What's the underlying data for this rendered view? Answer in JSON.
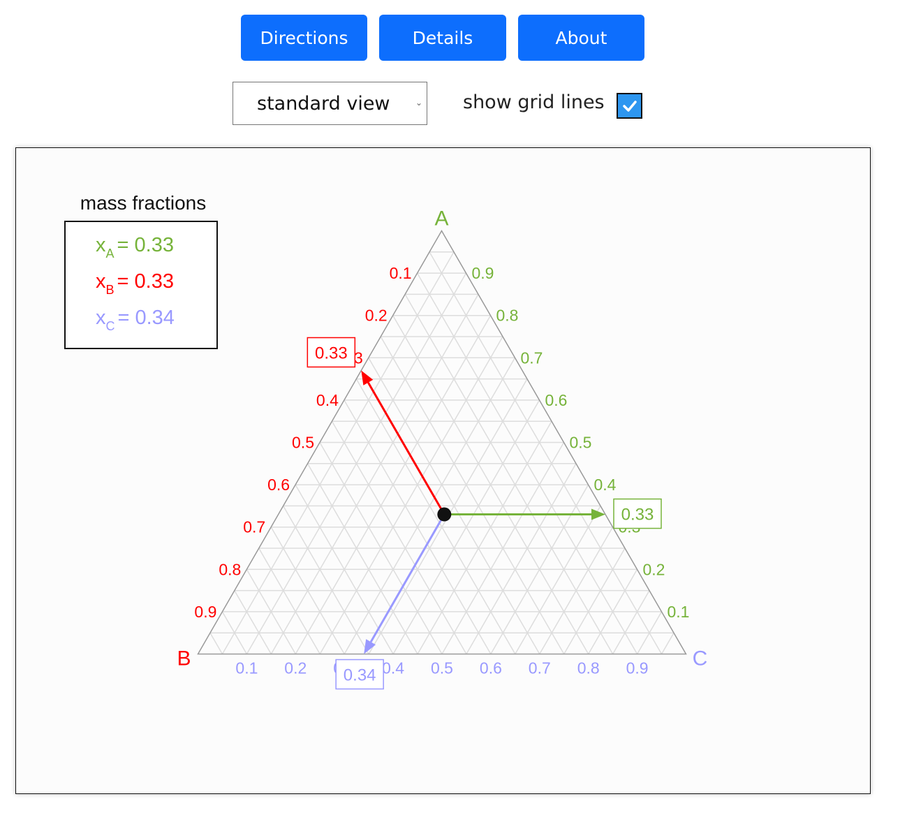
{
  "toolbar": {
    "buttons": [
      {
        "label": "Directions"
      },
      {
        "label": "Details"
      },
      {
        "label": "About"
      }
    ],
    "view_select": {
      "value": "standard view"
    },
    "grid_toggle": {
      "label": "show grid lines",
      "checked": true
    }
  },
  "colors": {
    "A": "#76b33a",
    "B": "#ff0000",
    "C": "#9999ff",
    "grid": "#dddddd",
    "axis": "#999999",
    "point": "#111111"
  },
  "legend": {
    "title": "mass fractions",
    "rows": [
      {
        "var": "x",
        "sub": "A",
        "text": "= 0.33"
      },
      {
        "var": "x",
        "sub": "B",
        "text": "= 0.33"
      },
      {
        "var": "x",
        "sub": "C",
        "text": "= 0.34"
      }
    ]
  },
  "chart_data": {
    "type": "ternary",
    "vertices": {
      "top": "A",
      "bottom_left": "B",
      "bottom_right": "C"
    },
    "ticks": [
      0.1,
      0.2,
      0.3,
      0.4,
      0.5,
      0.6,
      0.7,
      0.8,
      0.9
    ],
    "tick_labels": [
      "0.1",
      "0.2",
      "0.3",
      "0.4",
      "0.5",
      "0.6",
      "0.7",
      "0.8",
      "0.9"
    ],
    "grid_step": 0.05,
    "grid": true,
    "point": {
      "xA": 0.33,
      "xB": 0.33,
      "xC": 0.34
    },
    "value_boxes": {
      "A": "0.33",
      "B": "0.33",
      "C": "0.34"
    }
  }
}
